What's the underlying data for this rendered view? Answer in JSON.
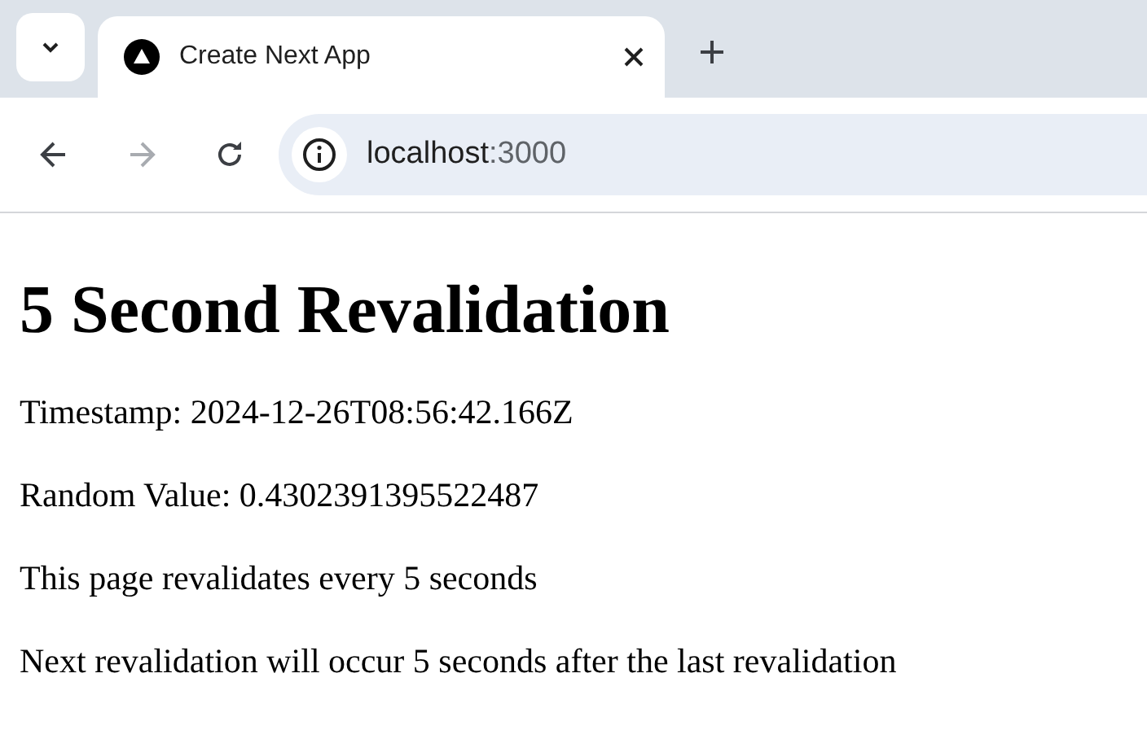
{
  "browser": {
    "tabs": [
      {
        "title": "Create Next App",
        "selected": true
      }
    ],
    "nav": {
      "back_disabled": false,
      "forward_disabled": true
    },
    "address": {
      "host": "localhost",
      "port": ":3000"
    }
  },
  "page": {
    "heading": "5 Second Revalidation",
    "paragraphs": [
      "Timestamp: 2024-12-26T08:56:42.166Z",
      "Random Value: 0.4302391395522487",
      "This page revalidates every 5 seconds",
      "Next revalidation will occur 5 seconds after the last revalidation"
    ]
  }
}
